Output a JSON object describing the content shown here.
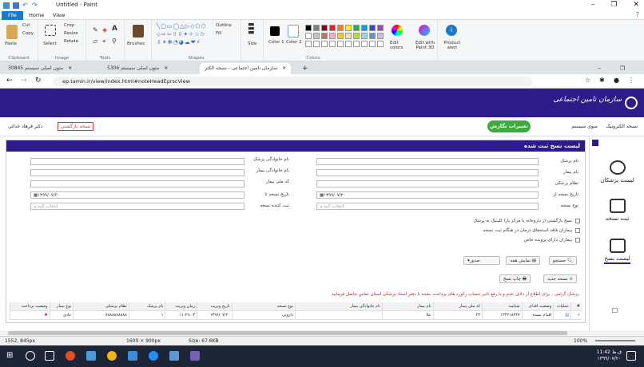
{
  "paint": {
    "title": "Untitled - Paint",
    "tabs": [
      "File",
      "Home",
      "View"
    ],
    "clipboard": {
      "paste": "Paste",
      "cut": "Cut",
      "copy": "Copy",
      "group": "Clipboard"
    },
    "image": {
      "select": "Select",
      "crop": "Crop",
      "resize": "Resize",
      "rotate": "Rotate",
      "group": "Image"
    },
    "tools": {
      "group": "Tools"
    },
    "brushes": "Brushes",
    "shapes": {
      "outline": "Outline",
      "fill": "Fill",
      "group": "Shapes"
    },
    "size": "Size",
    "color1": "Color 1",
    "color2": "Color 2",
    "colors_group": "Colors",
    "edit_colors": "Edit colors",
    "edit_paint3d": "Edit with Paint 3D",
    "product_alert": "Product alert",
    "palette": [
      "#000000",
      "#7f7f7f",
      "#880015",
      "#ed1c24",
      "#ff7f27",
      "#fff200",
      "#22b14c",
      "#00a2e8",
      "#3f48cc",
      "#a349a4",
      "#ffffff",
      "#c3c3c3",
      "#b97a57",
      "#ffaec9",
      "#ffc90e",
      "#efe4b0",
      "#b5e61d",
      "#99d9ea",
      "#7092be",
      "#c8bfe7"
    ]
  },
  "browser": {
    "tabs": [
      {
        "label": "30845 متون اصلی سیستم"
      },
      {
        "label": "5306 متون اصلی سیستم"
      },
      {
        "label": "سازمان تامین اجتماعی - نسخه الکتر"
      }
    ],
    "url": "ep.tamin.ir/view/index.html#noteHeadEprscView"
  },
  "site": {
    "logo": "سازمان تامین اجتماعی",
    "nav_electronic": "نسخه الکترونیک",
    "nav_system_menu": "منوی سیستم",
    "change_btn": "تغییرات نگارش",
    "user": "دکتر فرهاد خدائی",
    "return_btn": "نسخه بازگشتی"
  },
  "sidebar": {
    "items": [
      {
        "label": "لیست پزشکان"
      },
      {
        "label": "ثبت نسخه"
      },
      {
        "label": "لیست نسخ"
      }
    ]
  },
  "panel": {
    "title": "لیست نسخ ثبت شده",
    "labels": {
      "doctor_name": "نام پزشک",
      "doctor_family": "نام خانوادگی پزشک",
      "patient_name": "نام بیمار",
      "patient_family": "نام خانوادگی بیمار",
      "medical_code": "نظام پزشکی",
      "national_code": "کد ملی بیمار",
      "date_from": "تاریخ نسخه از",
      "date_to": "تاریخ نسخه تا",
      "rx_type": "نوع نسخه",
      "issuer": "ثبت کننده نسخه"
    },
    "date_from_value": "۱۳۹۹/۰۷/۲۰",
    "date_to_value": "۱۳۹۹/۰۷/۲۰",
    "select_placeholder": "انتخاب کنید",
    "checks": [
      "نسخ بازگشتی از داروخانه یا مرکز پارا کلینیک به پزشک",
      "بیماران فاقد استحقاق درمان در هنگام ثبت نسخه",
      "بیماران دارای پرونده خاص"
    ],
    "search_btn": "جستجو",
    "show_all_btn": "نمایش همه",
    "issued_btn": "صدور",
    "new_rx_btn": "نسخه جدید",
    "print_btn": "چاپ نسخ",
    "notice": "پزشک گرامی ، برای اطلاع از دلایل عدم و یا رفع تاثیر حساب رکورد های پرداخت نشده با دفتر اسناد پزشکی استان تماس حاصل فرمایید."
  },
  "table": {
    "headers": [
      "#",
      "عملیات",
      "وضعیت اقدام",
      "شناسه",
      "کد ملی بیمار",
      "نام بیمار",
      "نام خانوادگی بیمار",
      "نوع نسخه",
      "تاریخ ویزیت",
      "زمان ویزیت",
      "نام پزشک",
      "نظام پزشکی",
      "نوع بیمار",
      "وضعیت پرداخت"
    ],
    "rows": [
      [
        "۱",
        "",
        "اقدام نشده",
        "۱۳۴۲۱۸۴۴۷",
        "۲۳",
        "علا",
        "",
        "دارویی",
        "۱۳۹۹/۰۷/۲۰",
        "۱۱:۲۹:۰۳",
        "۱",
        "۸۸۸۸۸۸۸۸۸۸",
        "عادی",
        ""
      ]
    ]
  },
  "status": {
    "coords": "1552, 845px",
    "dims": "1600 × 900px",
    "size": "Size: 67.6KB",
    "zoom": "100%"
  },
  "taskbar": {
    "time": "11:42 ق.ظ",
    "date": "۱۳۹۹/۰۷/۲۰"
  }
}
